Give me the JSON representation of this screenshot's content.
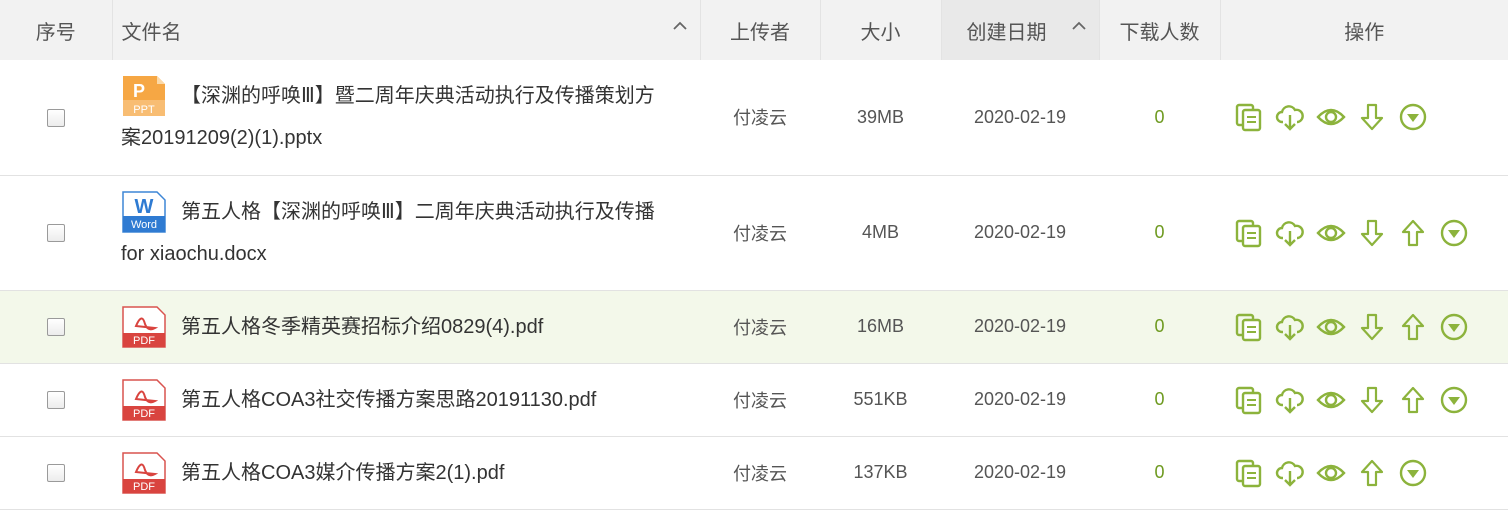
{
  "header": {
    "index": "序号",
    "filename": "文件名",
    "uploader": "上传者",
    "size": "大小",
    "created": "创建日期",
    "downloads": "下载人数",
    "actions": "操作"
  },
  "colors": {
    "accent_green": "#8cb33c",
    "download_count": "#6e9a20",
    "row_highlight": "#f3f8ea",
    "header_bg": "#f2f2f2"
  },
  "rows": [
    {
      "icon": "ppt-file-icon",
      "name_line1": "【深渊的呼唤Ⅲ】暨二周年庆典活动执行及传播策划方",
      "name_line2": "案20191209(2)(1).pptx",
      "uploader": "付凌云",
      "size": "39MB",
      "date": "2020-02-19",
      "downloads": "0",
      "actions": [
        "copy-icon",
        "cloud-download-icon",
        "preview-eye-icon",
        "download-arrow-icon",
        "more-dropdown-icon"
      ]
    },
    {
      "icon": "word-file-icon",
      "name_line1": "第五人格【深渊的呼唤Ⅲ】二周年庆典活动执行及传播",
      "name_line2": "for xiaochu.docx",
      "uploader": "付凌云",
      "size": "4MB",
      "date": "2020-02-19",
      "downloads": "0",
      "actions": [
        "copy-icon",
        "cloud-download-icon",
        "preview-eye-icon",
        "download-arrow-icon",
        "upload-arrow-icon",
        "more-dropdown-icon"
      ]
    },
    {
      "icon": "pdf-file-icon",
      "name_line1": "第五人格冬季精英赛招标介绍0829(4).pdf",
      "uploader": "付凌云",
      "size": "16MB",
      "date": "2020-02-19",
      "downloads": "0",
      "highlight": true,
      "actions": [
        "copy-icon",
        "cloud-download-icon",
        "preview-eye-icon",
        "download-arrow-icon",
        "upload-arrow-icon",
        "more-dropdown-icon"
      ]
    },
    {
      "icon": "pdf-file-icon",
      "name_line1": "第五人格COA3社交传播方案思路20191130.pdf",
      "uploader": "付凌云",
      "size": "551KB",
      "date": "2020-02-19",
      "downloads": "0",
      "actions": [
        "copy-icon",
        "cloud-download-icon",
        "preview-eye-icon",
        "download-arrow-icon",
        "upload-arrow-icon",
        "more-dropdown-icon"
      ]
    },
    {
      "icon": "pdf-file-icon",
      "name_line1": "第五人格COA3媒介传播方案2(1).pdf",
      "uploader": "付凌云",
      "size": "137KB",
      "date": "2020-02-19",
      "downloads": "0",
      "actions": [
        "copy-icon",
        "cloud-download-icon",
        "preview-eye-icon",
        "upload-arrow-icon",
        "more-dropdown-icon"
      ]
    }
  ]
}
